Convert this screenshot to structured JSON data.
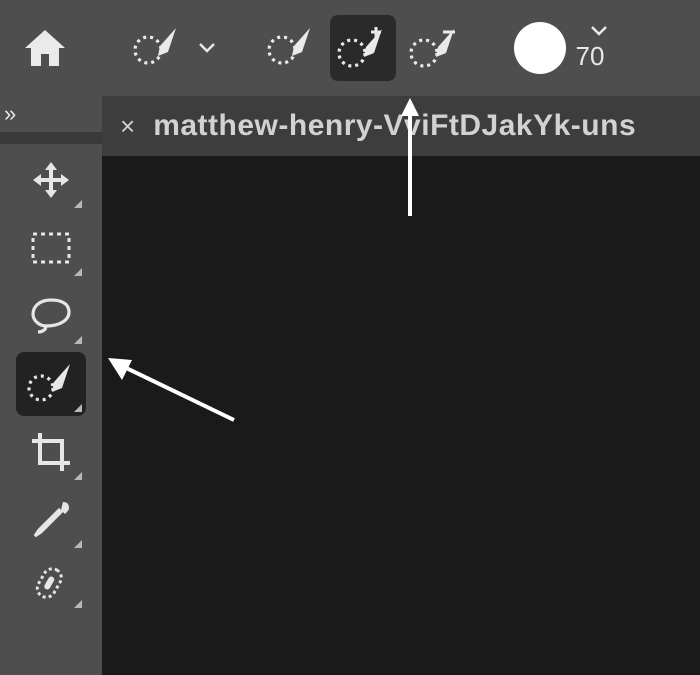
{
  "topbar": {
    "home_label": "home",
    "selection_brush_label": "selection-brush",
    "mode_new_label": "new-selection",
    "mode_add_label": "add-to-selection",
    "mode_subtract_label": "subtract-from-selection",
    "brush_color": "#ffffff",
    "brush_size": "70"
  },
  "left_panel": {
    "expand_label": "»"
  },
  "tools": {
    "move": "move-tool",
    "marquee": "rectangular-marquee-tool",
    "lasso": "lasso-tool",
    "quick_select": "quick-selection-tool",
    "crop": "crop-tool",
    "eyedropper": "eyedropper-tool",
    "healing": "spot-healing-brush-tool"
  },
  "tab": {
    "close": "×",
    "filename": "matthew-henry-VviFtDJakYk-uns"
  }
}
